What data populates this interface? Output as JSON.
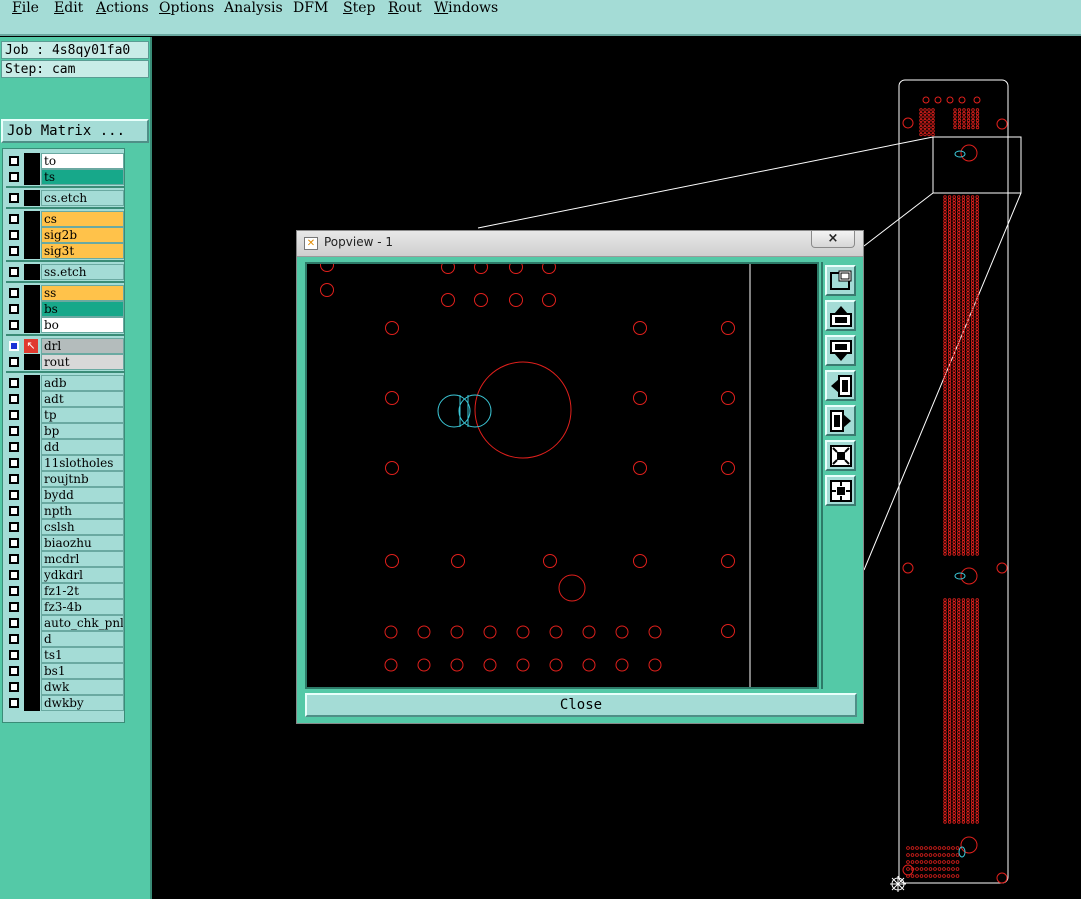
{
  "menu": [
    {
      "key": "F",
      "rest": "ile"
    },
    {
      "key": "E",
      "rest": "dit"
    },
    {
      "key": "A",
      "rest": "ctions"
    },
    {
      "key": "O",
      "rest": "ptions"
    },
    {
      "key": "",
      "rest": "Analysis"
    },
    {
      "key": "",
      "rest": "DFM"
    },
    {
      "key": "S",
      "rest": "tep"
    },
    {
      "key": "R",
      "rest": "out"
    },
    {
      "key": "W",
      "rest": "indows"
    }
  ],
  "job_label": "Job : 4s8qy01fa0",
  "step_label": "Step: cam",
  "job_matrix_label": "Job Matrix ...",
  "layers": [
    {
      "name": "to",
      "color": "#ffffff"
    },
    {
      "name": "ts",
      "color": "#17a88a"
    },
    {
      "name": "cs.etch",
      "color": "#a4dcd6"
    },
    {
      "name": "cs",
      "color": "#ffc24a"
    },
    {
      "name": "sig2b",
      "color": "#ffc24a"
    },
    {
      "name": "sig3t",
      "color": "#ffc24a"
    },
    {
      "name": "ss.etch",
      "color": "#a4dcd6"
    },
    {
      "name": "ss",
      "color": "#ffc24a"
    },
    {
      "name": "bs",
      "color": "#17a88a"
    },
    {
      "name": "bo",
      "color": "#ffffff"
    },
    {
      "name": "drl",
      "color": "#b4bcbc"
    },
    {
      "name": "rout",
      "color": "#d8d8d8"
    },
    {
      "name": "adb",
      "color": "#a4dcd6"
    },
    {
      "name": "adt",
      "color": "#a4dcd6"
    },
    {
      "name": "tp",
      "color": "#a4dcd6"
    },
    {
      "name": "bp",
      "color": "#a4dcd6"
    },
    {
      "name": "dd",
      "color": "#a4dcd6"
    },
    {
      "name": "11slotholes",
      "color": "#a4dcd6"
    },
    {
      "name": "roujtnb",
      "color": "#a4dcd6"
    },
    {
      "name": "bydd",
      "color": "#a4dcd6"
    },
    {
      "name": "npth",
      "color": "#a4dcd6"
    },
    {
      "name": "cslsh",
      "color": "#a4dcd6"
    },
    {
      "name": "biaozhu",
      "color": "#a4dcd6"
    },
    {
      "name": "mcdrl",
      "color": "#a4dcd6"
    },
    {
      "name": "ydkdrl",
      "color": "#a4dcd6"
    },
    {
      "name": "fz1-2t",
      "color": "#a4dcd6"
    },
    {
      "name": "fz3-4b",
      "color": "#a4dcd6"
    },
    {
      "name": "auto_chk_pnl",
      "color": "#a4dcd6"
    },
    {
      "name": "d",
      "color": "#a4dcd6"
    },
    {
      "name": "ts1",
      "color": "#a4dcd6"
    },
    {
      "name": "bs1",
      "color": "#a4dcd6"
    },
    {
      "name": "dwk",
      "color": "#a4dcd6"
    },
    {
      "name": "dwkby",
      "color": "#a4dcd6"
    }
  ],
  "popup": {
    "title": "Popview - 1",
    "close_x": "×",
    "close_button": "Close"
  },
  "colors": {
    "pad": "#e0201c",
    "slot": "#3cc8d8",
    "outline": "#ffffff",
    "panel": "#54c9a7",
    "field": "#a4dcd6"
  }
}
